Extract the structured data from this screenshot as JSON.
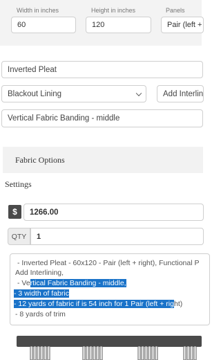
{
  "dimensions": {
    "width_label": "Width in inches",
    "width_value": "60",
    "height_label": "Height in inches",
    "height_value": "120",
    "panels_label": "Panels",
    "panels_value": "Pair (left +"
  },
  "options": {
    "pleat": "Inverted Pleat",
    "lining": "Blackout Lining",
    "interlining": "Add Interlinin",
    "banding": "Vertical Fabric Banding - middle"
  },
  "section": {
    "title": "Fabric Options",
    "settings_label": "Settings"
  },
  "price": {
    "currency_symbol": "$",
    "value": "1266.00"
  },
  "quantity": {
    "label": "QTY",
    "value": "1"
  },
  "notes": {
    "line1": "- Inverted Pleat - 60x120 - Pair (left + right), Functional P",
    "line2": "Add Interlining,",
    "line3_pre": "- Ve",
    "line3_sel": "rtical Fabric Banding - middle,",
    "line4": "- 3 width of fabric",
    "line5_sel": "- 12 yards of fabric if is 54 inch for 1 Pair (left + rig",
    "line5_post": "ht)",
    "line6": "- 8 yards of trim"
  },
  "colors": {
    "selection": "#1a73c9",
    "dark": "#4a4a4a"
  }
}
